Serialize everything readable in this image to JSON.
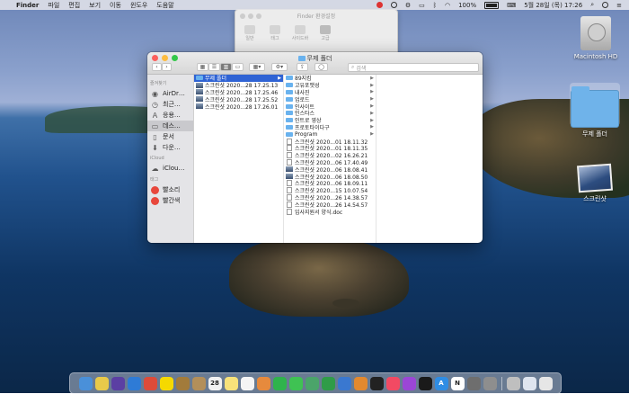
{
  "menubar": {
    "app": "Finder",
    "items": [
      "파일",
      "편집",
      "보기",
      "이동",
      "윈도우",
      "도움말"
    ],
    "battery": "100%",
    "datetime": "5월 28일 (목)  17:26"
  },
  "prefs_window": {
    "title": "Finder 환경설정",
    "tabs": [
      "일반",
      "태그",
      "사이드바",
      "고급"
    ]
  },
  "finder": {
    "title": "무제 폴더",
    "search_placeholder": "검색",
    "sidebar": {
      "favorites_header": "즐겨찾기",
      "favorites": [
        {
          "label": "AirDr…",
          "icon": "airdrop-icon"
        },
        {
          "label": "최근…",
          "icon": "clock-icon"
        },
        {
          "label": "응용…",
          "icon": "applications-icon"
        },
        {
          "label": "데스…",
          "icon": "desktop-icon"
        },
        {
          "label": "문서",
          "icon": "document-icon"
        },
        {
          "label": "다운…",
          "icon": "download-icon"
        }
      ],
      "icloud_header": "iCloud",
      "icloud": [
        {
          "label": "iClou…",
          "icon": "cloud-icon"
        }
      ],
      "tags_header": "태그",
      "tags": [
        {
          "label": "빨소리",
          "color": "#e8473c"
        },
        {
          "label": "빨간색",
          "color": "#e8473c"
        }
      ]
    },
    "col1": [
      {
        "name": "무제 폴더",
        "type": "folder",
        "selected": true
      },
      {
        "name": "스크린샷 2020...28 17.25.13",
        "type": "image"
      },
      {
        "name": "스크린샷 2020...28 17.25.46",
        "type": "image"
      },
      {
        "name": "스크린샷 2020...28 17.25.52",
        "type": "image"
      },
      {
        "name": "스크린샷 2020...28 17.26.01",
        "type": "image"
      }
    ],
    "col2": [
      {
        "name": "89지킴",
        "type": "folder"
      },
      {
        "name": "고유포맷성",
        "type": "folder"
      },
      {
        "name": "내사진",
        "type": "folder"
      },
      {
        "name": "업로드",
        "type": "folder"
      },
      {
        "name": "인사이트",
        "type": "folder"
      },
      {
        "name": "인스타스",
        "type": "folder"
      },
      {
        "name": "인트로 영상",
        "type": "folder"
      },
      {
        "name": "프로토타이다구",
        "type": "folder"
      },
      {
        "name": "Program",
        "type": "folder"
      },
      {
        "name": "스크린샷 2020...01 18.11.32",
        "type": "doc"
      },
      {
        "name": "스크린샷 2020...01 18.11.35",
        "type": "doc"
      },
      {
        "name": "스크린샷 2020...02 16.26.21",
        "type": "doc"
      },
      {
        "name": "스크린샷 2020...06 17.40.49",
        "type": "doc"
      },
      {
        "name": "스크린샷 2020...06 18.08.41",
        "type": "image"
      },
      {
        "name": "스크린샷 2020...06 18.08.50",
        "type": "image"
      },
      {
        "name": "스크린샷 2020...06 18.09.11",
        "type": "doc"
      },
      {
        "name": "스크린샷 2020...15 10.07.54",
        "type": "doc"
      },
      {
        "name": "스크린샷 2020...26 14.38.57",
        "type": "doc"
      },
      {
        "name": "스크린샷 2020...26 14.54.57",
        "type": "doc"
      },
      {
        "name": "입사지원서 양식.doc",
        "type": "doc"
      }
    ]
  },
  "desktop": {
    "hd_label": "Macintosh HD",
    "folder_label": "무제 폴더",
    "screenshot_label": "스크린샷"
  },
  "dock": {
    "apps": [
      {
        "name": "finder-dock-icon",
        "color": "#4a90d9",
        "glyph": ""
      },
      {
        "name": "stickies-dock-icon",
        "color": "#e8c94a",
        "glyph": ""
      },
      {
        "name": "siri-dock-icon",
        "color": "#5b3fa3",
        "glyph": ""
      },
      {
        "name": "safari-dock-icon",
        "color": "#2e7bd6",
        "glyph": ""
      },
      {
        "name": "chrome-dock-icon",
        "color": "#dd4b39",
        "glyph": ""
      },
      {
        "name": "kakaotalk-dock-icon",
        "color": "#f5d900",
        "glyph": ""
      },
      {
        "name": "notes-brown-dock-icon",
        "color": "#a27b3b",
        "glyph": ""
      },
      {
        "name": "contacts-dock-icon",
        "color": "#b38f5a",
        "glyph": ""
      },
      {
        "name": "calendar-dock-icon",
        "color": "#f2f2f2",
        "glyph": "28"
      },
      {
        "name": "notes-dock-icon",
        "color": "#f7e27a",
        "glyph": ""
      },
      {
        "name": "reminders-dock-icon",
        "color": "#f5f5f5",
        "glyph": ""
      },
      {
        "name": "photos-dock-icon",
        "color": "#e68a3d",
        "glyph": ""
      },
      {
        "name": "facetime-dock-icon",
        "color": "#2fb34c",
        "glyph": ""
      },
      {
        "name": "messages-dock-icon",
        "color": "#3fc253",
        "glyph": ""
      },
      {
        "name": "maps-dock-icon",
        "color": "#4ba46a",
        "glyph": ""
      },
      {
        "name": "numbers-dock-icon",
        "color": "#2f9c48",
        "glyph": ""
      },
      {
        "name": "keynote-dock-icon",
        "color": "#3a78d0",
        "glyph": ""
      },
      {
        "name": "pages-dock-icon",
        "color": "#e2892f",
        "glyph": ""
      },
      {
        "name": "movie-dock-icon",
        "color": "#222222",
        "glyph": ""
      },
      {
        "name": "music-dock-icon",
        "color": "#f24a63",
        "glyph": ""
      },
      {
        "name": "podcasts-dock-icon",
        "color": "#9b46d6",
        "glyph": ""
      },
      {
        "name": "tv-dock-icon",
        "color": "#1a1a1a",
        "glyph": ""
      },
      {
        "name": "appstore-dock-icon",
        "color": "#2f8de4",
        "glyph": "A"
      },
      {
        "name": "notion-dock-icon",
        "color": "#ffffff",
        "glyph": "N"
      },
      {
        "name": "launchpad-dock-icon",
        "color": "#6e6e6e",
        "glyph": ""
      },
      {
        "name": "settings-dock-icon",
        "color": "#8e8e8e",
        "glyph": ""
      },
      {
        "name": "screenshot-dock-icon",
        "color": "#bfbfbf",
        "glyph": ""
      },
      {
        "name": "downloads-dock-icon",
        "color": "#dfe5ef",
        "glyph": ""
      },
      {
        "name": "trash-dock-icon",
        "color": "#e6e6e6",
        "glyph": ""
      }
    ]
  }
}
